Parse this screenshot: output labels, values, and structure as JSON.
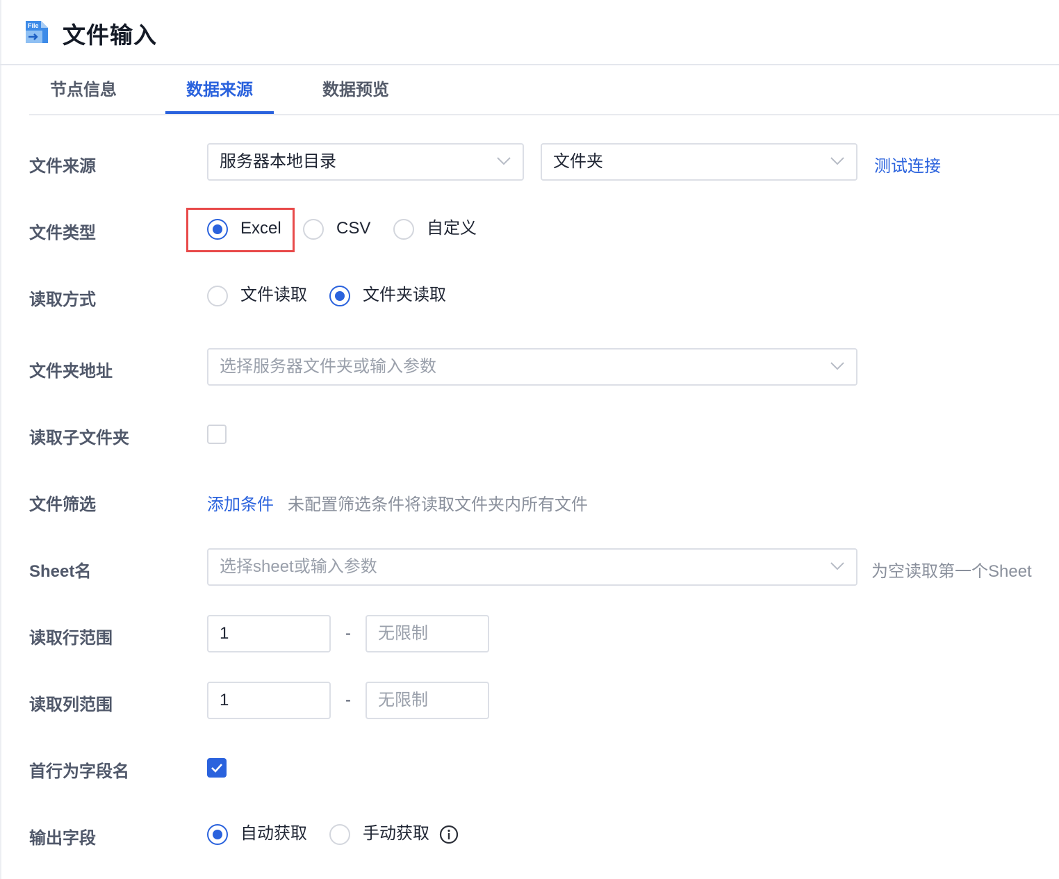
{
  "header": {
    "title": "文件输入",
    "icon": "file-input-icon"
  },
  "tabs": [
    {
      "label": "节点信息",
      "active": false
    },
    {
      "label": "数据来源",
      "active": true
    },
    {
      "label": "数据预览",
      "active": false
    }
  ],
  "form": {
    "file_source": {
      "label": "文件来源",
      "source_select": "服务器本地目录",
      "type_select": "文件夹",
      "test_link": "测试连接"
    },
    "file_type": {
      "label": "文件类型",
      "options": [
        "Excel",
        "CSV",
        "自定义"
      ],
      "selected": "Excel"
    },
    "read_mode": {
      "label": "读取方式",
      "options": [
        "文件读取",
        "文件夹读取"
      ],
      "selected": "文件夹读取"
    },
    "folder_path": {
      "label": "文件夹地址",
      "placeholder": "选择服务器文件夹或输入参数"
    },
    "read_subfolder": {
      "label": "读取子文件夹",
      "checked": false
    },
    "file_filter": {
      "label": "文件筛选",
      "add_link": "添加条件",
      "hint": "未配置筛选条件将读取文件夹内所有文件"
    },
    "sheet_name": {
      "label": "Sheet名",
      "placeholder": "选择sheet或输入参数",
      "hint": "为空读取第一个Sheet"
    },
    "row_range": {
      "label": "读取行范围",
      "start": "1",
      "separator": "-",
      "end_placeholder": "无限制"
    },
    "col_range": {
      "label": "读取列范围",
      "start": "1",
      "separator": "-",
      "end_placeholder": "无限制"
    },
    "first_row_header": {
      "label": "首行为字段名",
      "checked": true
    },
    "output_fields": {
      "label": "输出字段",
      "options": [
        "自动获取",
        "手动获取"
      ],
      "selected": "自动获取"
    }
  },
  "colors": {
    "primary": "#2a62dd",
    "highlight": "#e84a4a",
    "label": "#50586a",
    "placeholder": "#9aa0ab"
  }
}
